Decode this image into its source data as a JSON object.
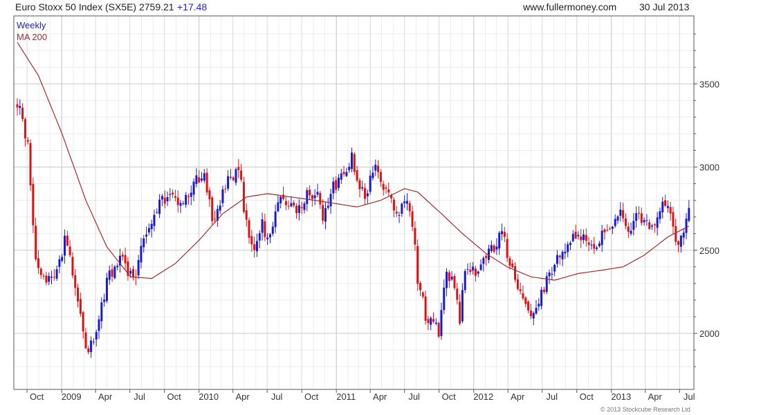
{
  "header": {
    "title": "Euro Stoxx 50 Index (SX5E) 2759.21",
    "change": "+17.48",
    "site": "www.fullermoney.com",
    "date": "30 Jul 2013"
  },
  "copyright": "© 2013 Stockcube Research Ltd",
  "colors": {
    "up": "#1a1acc",
    "down": "#dd1111",
    "ma": "#a52a2a",
    "grid": "#d4d4d4",
    "frame": "#555555",
    "weekly_label": "#2222aa",
    "ma_label": "#a52a2a"
  },
  "chart_data": {
    "type": "candlestick",
    "title": "Euro Stoxx 50 Index (SX5E)",
    "frequency": "Weekly",
    "series": [
      {
        "name": "Weekly",
        "kind": "candles",
        "values": []
      },
      {
        "name": "MA 200",
        "kind": "line"
      }
    ],
    "x_tick_labels": [
      "Oct",
      "2009",
      "Apr",
      "Jul",
      "Oct",
      "2010",
      "Apr",
      "Jul",
      "Oct",
      "2011",
      "Apr",
      "Jul",
      "Oct",
      "2012",
      "Apr",
      "Jul",
      "Oct",
      "2013",
      "Apr",
      "Jul"
    ],
    "y_ticks": [
      2000,
      2500,
      3000,
      3500
    ],
    "ylim": [
      1750,
      3800
    ],
    "x_range": [
      "2008-09-05",
      "2013-07-30"
    ],
    "grid": true,
    "legend_position": "top-left",
    "y_axis_side": "right",
    "close_path": [
      [
        "2008-09-05",
        3400
      ],
      [
        "2008-10-03",
        3150
      ],
      [
        "2008-10-24",
        2450
      ],
      [
        "2008-11-21",
        2300
      ],
      [
        "2008-12-19",
        2400
      ],
      [
        "2009-01-09",
        2550
      ],
      [
        "2009-02-06",
        2300
      ],
      [
        "2009-02-27",
        2000
      ],
      [
        "2009-03-09",
        1810
      ],
      [
        "2009-04-10",
        2120
      ],
      [
        "2009-05-08",
        2360
      ],
      [
        "2009-06-12",
        2450
      ],
      [
        "2009-07-10",
        2300
      ],
      [
        "2009-08-07",
        2600
      ],
      [
        "2009-09-11",
        2750
      ],
      [
        "2009-10-16",
        2850
      ],
      [
        "2009-11-13",
        2800
      ],
      [
        "2009-12-18",
        2880
      ],
      [
        "2010-01-15",
        3000
      ],
      [
        "2010-02-05",
        2650
      ],
      [
        "2010-03-05",
        2850
      ],
      [
        "2010-04-16",
        3000
      ],
      [
        "2010-05-07",
        2650
      ],
      [
        "2010-05-21",
        2500
      ],
      [
        "2010-06-18",
        2650
      ],
      [
        "2010-07-02",
        2550
      ],
      [
        "2010-08-06",
        2800
      ],
      [
        "2010-09-10",
        2750
      ],
      [
        "2010-10-15",
        2820
      ],
      [
        "2010-11-12",
        2850
      ],
      [
        "2010-11-26",
        2660
      ],
      [
        "2010-12-17",
        2850
      ],
      [
        "2011-01-14",
        2960
      ],
      [
        "2011-02-11",
        3050
      ],
      [
        "2011-03-18",
        2800
      ],
      [
        "2011-04-08",
        3000
      ],
      [
        "2011-05-13",
        2850
      ],
      [
        "2011-06-17",
        2720
      ],
      [
        "2011-07-08",
        2820
      ],
      [
        "2011-07-22",
        2680
      ],
      [
        "2011-08-05",
        2300
      ],
      [
        "2011-08-26",
        2120
      ],
      [
        "2011-09-16",
        2060
      ],
      [
        "2011-09-30",
        2000
      ],
      [
        "2011-10-21",
        2350
      ],
      [
        "2011-11-11",
        2300
      ],
      [
        "2011-11-25",
        2100
      ],
      [
        "2011-12-09",
        2350
      ],
      [
        "2012-01-13",
        2400
      ],
      [
        "2012-02-10",
        2500
      ],
      [
        "2012-03-16",
        2580
      ],
      [
        "2012-04-13",
        2400
      ],
      [
        "2012-05-11",
        2200
      ],
      [
        "2012-06-01",
        2100
      ],
      [
        "2012-06-22",
        2200
      ],
      [
        "2012-07-13",
        2300
      ],
      [
        "2012-08-10",
        2450
      ],
      [
        "2012-09-14",
        2580
      ],
      [
        "2012-10-19",
        2550
      ],
      [
        "2012-11-16",
        2480
      ],
      [
        "2012-12-21",
        2640
      ],
      [
        "2013-01-25",
        2720
      ],
      [
        "2013-02-22",
        2600
      ],
      [
        "2013-03-15",
        2720
      ],
      [
        "2013-04-19",
        2620
      ],
      [
        "2013-05-17",
        2800
      ],
      [
        "2013-06-07",
        2700
      ],
      [
        "2013-06-21",
        2550
      ],
      [
        "2013-07-05",
        2600
      ],
      [
        "2013-07-30",
        2759
      ]
    ],
    "ma_path": [
      [
        "2008-09-05",
        3750
      ],
      [
        "2008-10-31",
        3550
      ],
      [
        "2009-01-02",
        3200
      ],
      [
        "2009-03-06",
        2800
      ],
      [
        "2009-05-01",
        2520
      ],
      [
        "2009-07-03",
        2340
      ],
      [
        "2009-08-28",
        2330
      ],
      [
        "2009-10-30",
        2420
      ],
      [
        "2010-01-01",
        2560
      ],
      [
        "2010-03-05",
        2720
      ],
      [
        "2010-05-07",
        2820
      ],
      [
        "2010-07-02",
        2840
      ],
      [
        "2010-09-03",
        2820
      ],
      [
        "2010-11-05",
        2800
      ],
      [
        "2010-12-31",
        2780
      ],
      [
        "2011-02-25",
        2760
      ],
      [
        "2011-04-29",
        2800
      ],
      [
        "2011-07-01",
        2870
      ],
      [
        "2011-08-05",
        2850
      ],
      [
        "2011-10-07",
        2720
      ],
      [
        "2011-12-02",
        2600
      ],
      [
        "2012-02-03",
        2480
      ],
      [
        "2012-03-30",
        2400
      ],
      [
        "2012-06-01",
        2340
      ],
      [
        "2012-08-03",
        2320
      ],
      [
        "2012-10-05",
        2360
      ],
      [
        "2012-12-07",
        2380
      ],
      [
        "2013-02-01",
        2400
      ],
      [
        "2013-03-29",
        2470
      ],
      [
        "2013-05-31",
        2580
      ],
      [
        "2013-07-30",
        2650
      ]
    ]
  }
}
